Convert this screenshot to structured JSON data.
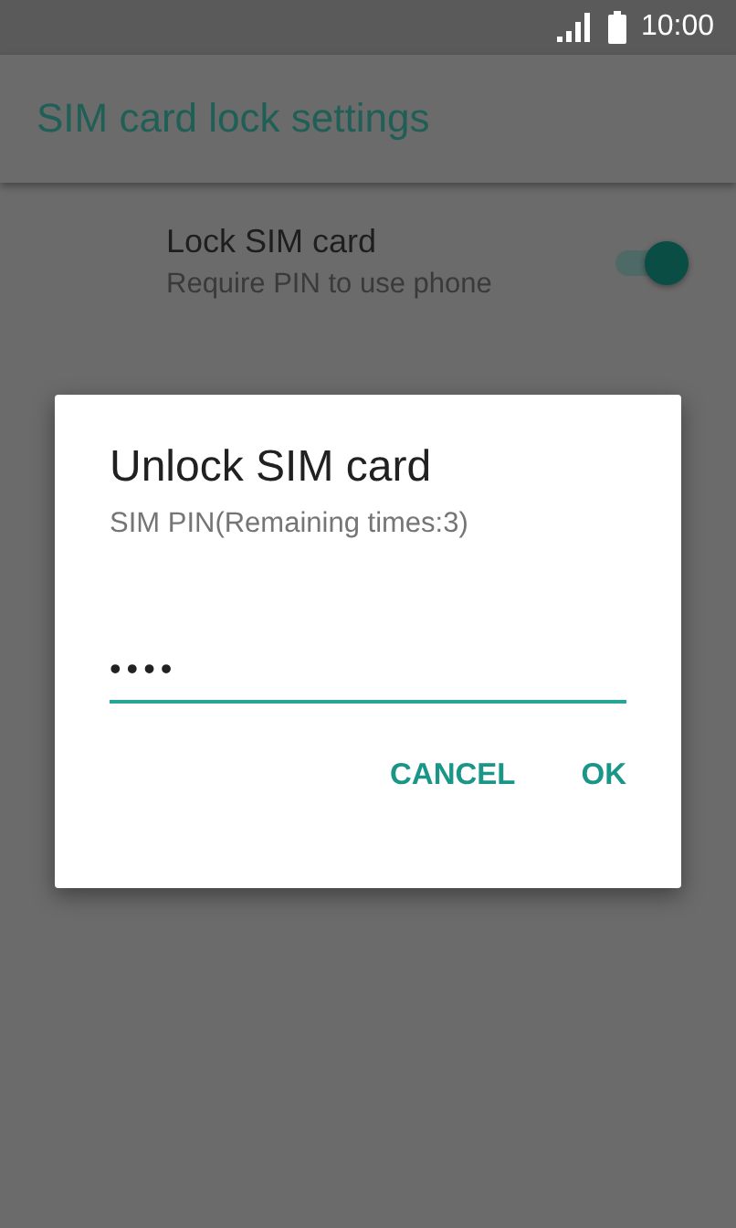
{
  "status_bar": {
    "time": "10:00"
  },
  "app_bar": {
    "title": "SIM card lock settings"
  },
  "settings": [
    {
      "title": "Lock SIM card",
      "summary": "Require PIN to use phone",
      "on": true
    }
  ],
  "dialog": {
    "title": "Unlock SIM card",
    "message": "SIM PIN(Remaining times:3)",
    "pin_field": {
      "value": "••••"
    },
    "buttons": [
      {
        "label": "CANCEL"
      },
      {
        "label": "OK"
      }
    ]
  }
}
